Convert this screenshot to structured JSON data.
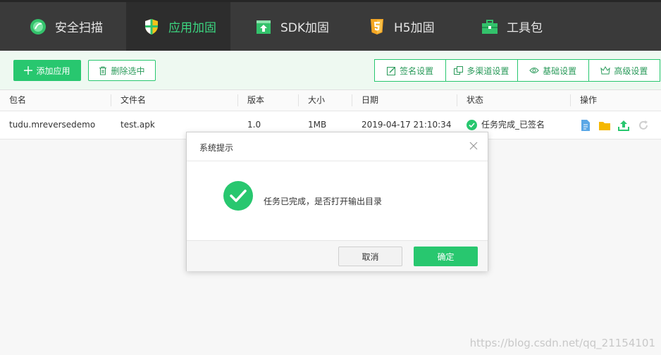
{
  "nav": {
    "tabs": [
      {
        "label": "安全扫描",
        "icon": "security-scan-icon"
      },
      {
        "label": "应用加固",
        "icon": "shield-icon"
      },
      {
        "label": "SDK加固",
        "icon": "sdk-upload-icon"
      },
      {
        "label": "H5加固",
        "icon": "html5-icon"
      },
      {
        "label": "工具包",
        "icon": "toolbox-icon"
      }
    ],
    "active_index": 1
  },
  "toolbar": {
    "add_label": "添加应用",
    "delete_label": "删除选中",
    "settings": [
      {
        "label": "签名设置",
        "icon": "signature-edit-icon"
      },
      {
        "label": "多渠道设置",
        "icon": "multi-channel-icon"
      },
      {
        "label": "基础设置",
        "icon": "basic-settings-eye-icon"
      },
      {
        "label": "高级设置",
        "icon": "crown-icon"
      }
    ]
  },
  "table": {
    "headers": [
      "包名",
      "文件名",
      "版本",
      "大小",
      "日期",
      "状态",
      "操作"
    ],
    "rows": [
      {
        "package": "tudu.mreversedemo",
        "file": "test.apk",
        "version": "1.0",
        "size": "1MB",
        "date": "2019-04-17 21:10:34",
        "status": "任务完成_已签名",
        "actions": [
          "document-icon",
          "folder-icon",
          "upload-icon",
          "refresh-icon"
        ]
      }
    ]
  },
  "dialog": {
    "title": "系统提示",
    "message": "任务已完成，是否打开输出目录",
    "cancel_label": "取消",
    "ok_label": "确定"
  },
  "watermark": "https://blog.csdn.net/qq_21154101",
  "colors": {
    "accent": "#28c76f",
    "nav_bg": "#3a3a3a",
    "active_tab_text": "#3cd680"
  }
}
